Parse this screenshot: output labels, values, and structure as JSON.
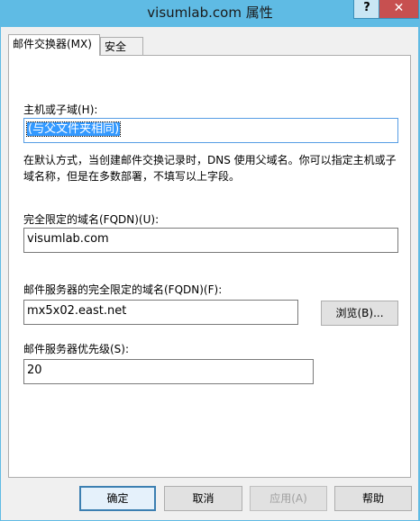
{
  "window": {
    "title": "visumlab.com 属性",
    "help_glyph": "?",
    "close_glyph": "✕"
  },
  "tabs": [
    {
      "label": "邮件交换器(MX)",
      "active": true
    },
    {
      "label": "安全",
      "active": false
    }
  ],
  "form": {
    "host_label": "主机或子域(H):",
    "host_value": "(与父文件夹相同)",
    "description": "在默认方式，当创建邮件交换记录时，DNS 使用父域名。你可以指定主机或子域名称，但是在多数部署，不填写以上字段。",
    "fqdn_label": "完全限定的域名(FQDN)(U):",
    "fqdn_value": "visumlab.com",
    "mail_server_label": "邮件服务器的完全限定的域名(FQDN)(F):",
    "mail_server_value": "mx5x02.east.net",
    "browse_label": "浏览(B)...",
    "priority_label": "邮件服务器优先级(S):",
    "priority_value": "20"
  },
  "buttons": {
    "ok": "确定",
    "cancel": "取消",
    "apply": "应用(A)",
    "help": "帮助"
  }
}
